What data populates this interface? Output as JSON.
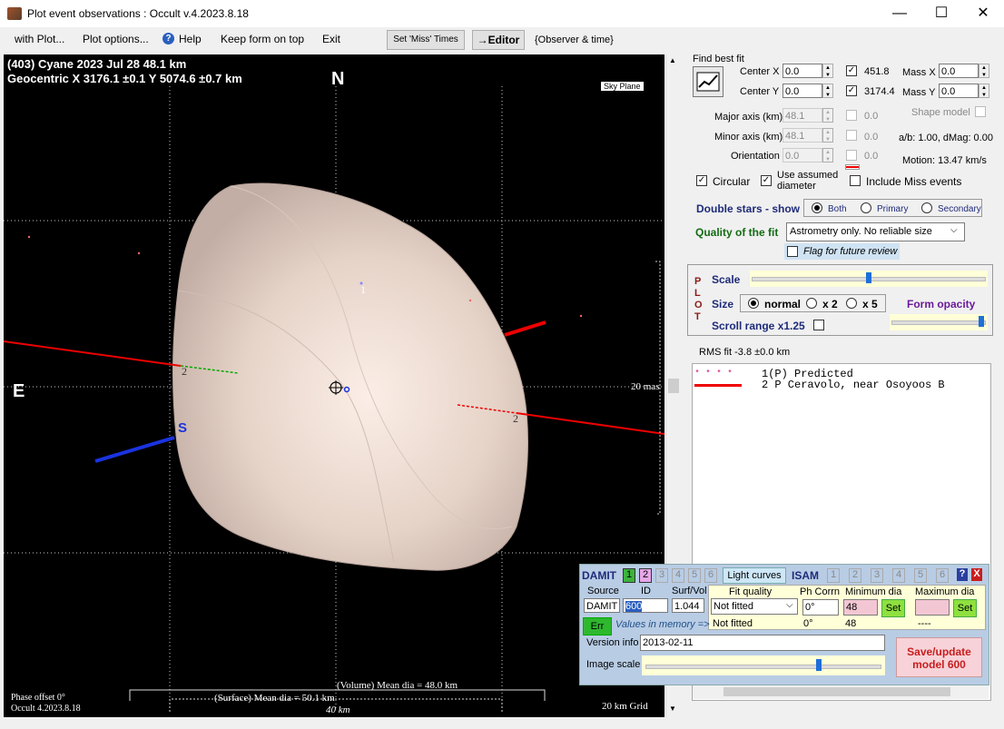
{
  "window": {
    "title": "Plot event observations : Occult v.4.2023.8.18",
    "minimize": "—",
    "maximize": "☐",
    "close": "✕"
  },
  "menu": {
    "with_plot": "with Plot...",
    "plot_options": "Plot options...",
    "help": "Help",
    "keep_on_top": "Keep form on top",
    "exit": "Exit",
    "set_miss_times": "Set 'Miss' Times",
    "editor": "→Editor",
    "observer_time": "{Observer & time}"
  },
  "plot": {
    "header_line1": "(403) Cyane  2023 Jul 28   48.1 km",
    "header_line2": "Geocentric  X  3176.1 ±0.1  Y 5074.6 ±0.7 km",
    "north": "N",
    "east": "E",
    "south": "S",
    "sky_plane": "Sky Plane",
    "mas_label": "20 mas",
    "chord1": "1",
    "chord2a": "2",
    "chord2b": "2",
    "volume_dia": "(Volume) Mean dia = 48.0 km",
    "surface_dia": "(Surface) Mean dia = 50.1 km",
    "scale_40km": "40 km",
    "phase_offset": "Phase offset 0°",
    "version": "Occult 4.2023.8.18",
    "grid": "20 km Grid"
  },
  "fit": {
    "find_best_fit": "Find best fit",
    "center_x_label": "Center X",
    "center_x": "0.0",
    "center_y_label": "Center Y",
    "center_y": "0.0",
    "value_x": "451.8",
    "value_y": "3174.4",
    "mass_x_label": "Mass X",
    "mass_x": "0.0",
    "mass_y_label": "Mass Y",
    "mass_y": "0.0",
    "major_label": "Major axis (km)",
    "major": "48.1",
    "major_side": "0.0",
    "minor_label": "Minor axis (km)",
    "minor": "48.1",
    "minor_side": "0.0",
    "orient_label": "Orientation",
    "orient": "0.0",
    "orient_side": "0.0",
    "shape_model": "Shape model",
    "ab_dmag": "a/b: 1.00, dMag: 0.00",
    "motion": "Motion: 13.47 km/s",
    "circular": "Circular",
    "use_assumed": "Use assumed",
    "diameter": "diameter",
    "include_miss": "Include Miss events",
    "double_stars": "Double stars - show",
    "both": "Both",
    "primary": "Primary",
    "secondary": "Secondary",
    "quality_label": "Quality of the fit",
    "quality_value": "Astrometry only. No reliable size",
    "flag_review": "Flag for future review"
  },
  "plotbox": {
    "plot_vertical": [
      "P",
      "L",
      "O",
      "T"
    ],
    "scale": "Scale",
    "size": "Size",
    "normal": "normal",
    "x2": "x 2",
    "x5": "x 5",
    "form_opacity": "Form opacity",
    "scroll_range": "Scroll range x1.25"
  },
  "results": {
    "rms": "RMS fit -3.8 ±0.0 km",
    "row1_marker": "• • • •",
    "row1_text": "1(P) Predicted",
    "row2_text": "2    P Ceravolo, near Osoyoos B"
  },
  "damit": {
    "damit": "DAMIT",
    "tabs": [
      "1",
      "2",
      "3",
      "4",
      "5",
      "6"
    ],
    "light_curves": "Light curves",
    "isam": "ISAM",
    "isam_tabs": [
      "1",
      "2",
      "3",
      "4",
      "5",
      "6"
    ],
    "help": "?",
    "close": "X",
    "source_label": "Source",
    "id_label": "ID",
    "surfvol_label": "Surf/Vol",
    "source": "DAMIT",
    "id": "600",
    "surfvol": "1.044",
    "fit_quality_label": "Fit quality",
    "ph_corrn_label": "Ph Corrn",
    "min_dia_label": "Minimum dia",
    "max_dia_label": "Maximum dia",
    "fit_quality": "Not fitted",
    "ph_corrn": "0°",
    "min_dia": "48",
    "set": "Set",
    "fit_quality2": "Not fitted",
    "ph_corrn2": "0°",
    "min_dia2": "48",
    "max_dia2": "----",
    "err": "Err",
    "values_in_memory": "Values in memory =>",
    "version_label": "Version info",
    "version": "2013-02-11",
    "image_scale": "Image scale",
    "save_update": "Save/update",
    "save_model": "model 600"
  }
}
